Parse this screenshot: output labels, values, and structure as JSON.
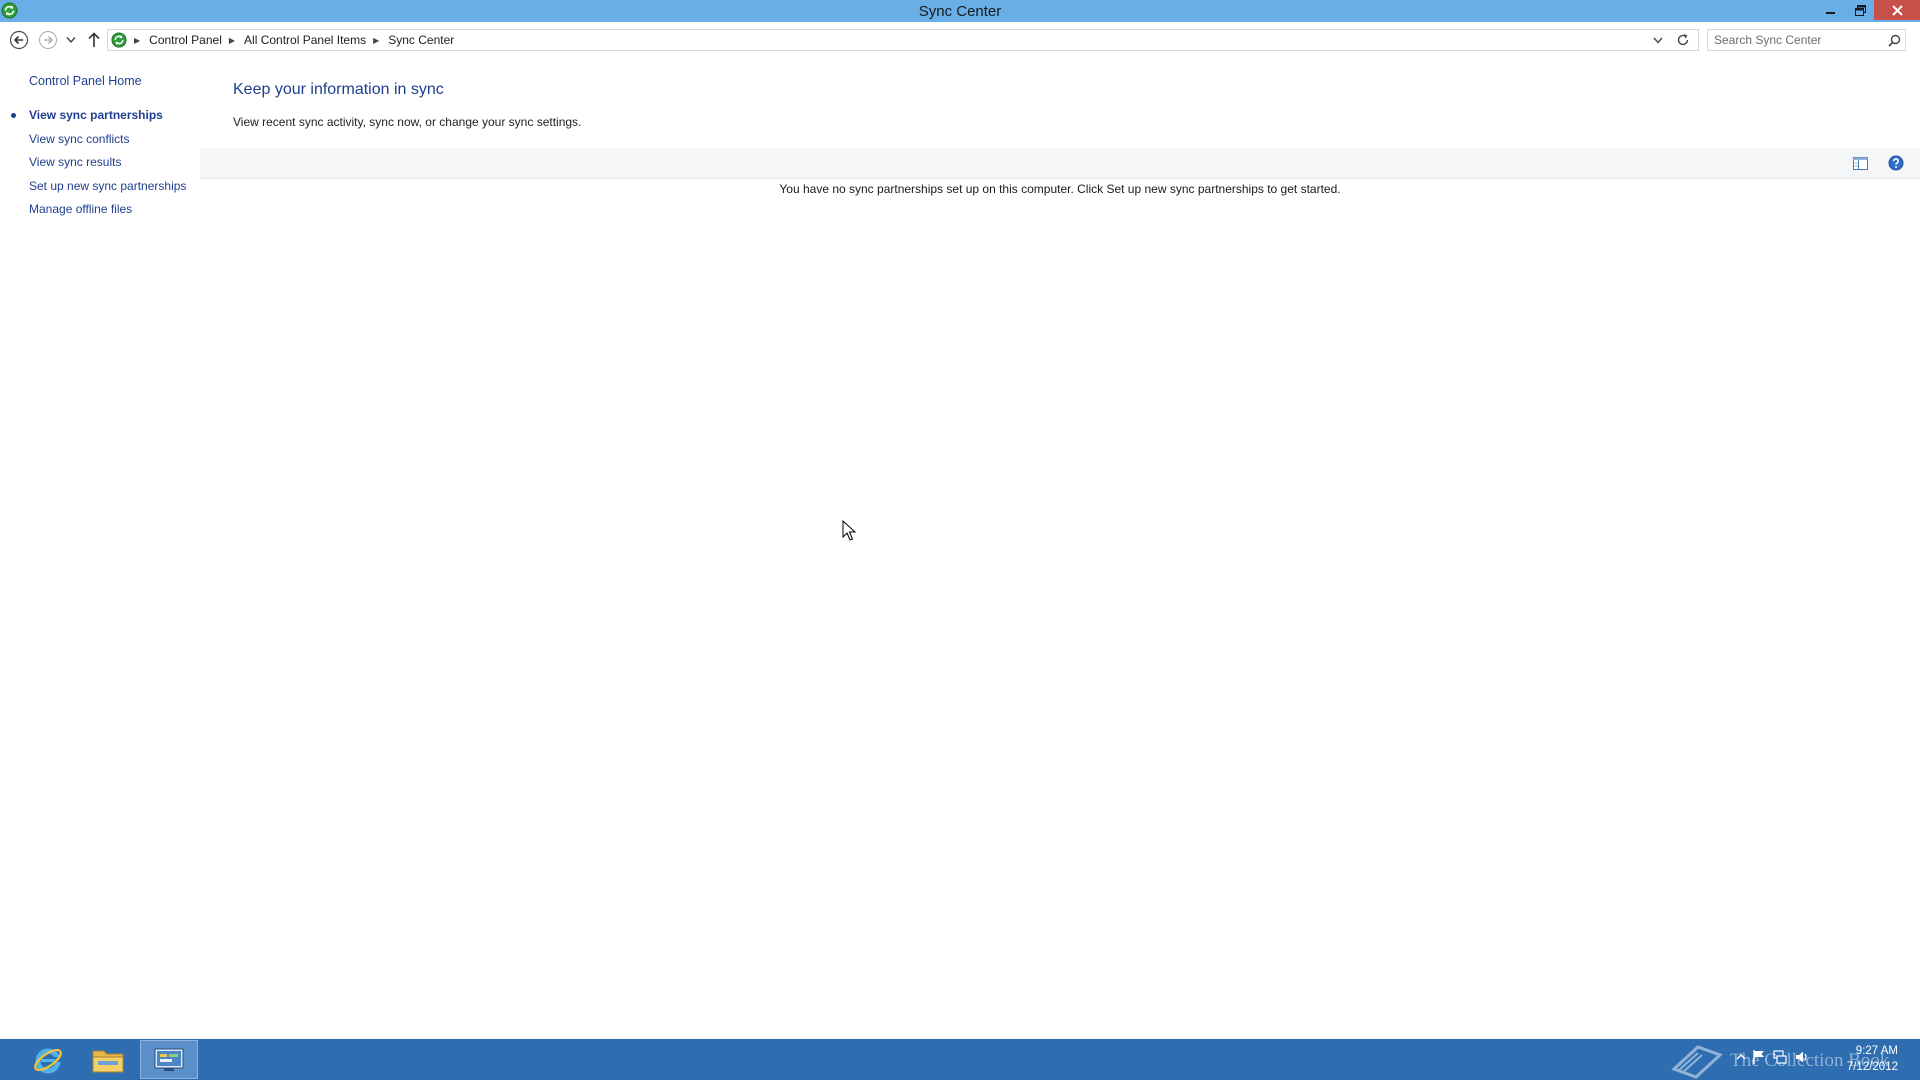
{
  "window": {
    "title": "Sync Center",
    "icon": "sync-center-icon",
    "controls": [
      "minimize-icon",
      "restore-icon",
      "close-icon"
    ]
  },
  "navigation": {
    "breadcrumbs": [
      "Control Panel",
      "All Control Panel Items",
      "Sync Center"
    ],
    "search_placeholder": "Search Sync Center"
  },
  "left_pane": {
    "home_link": "Control Panel Home",
    "tasks": [
      {
        "label": "View sync partnerships",
        "current": true
      },
      {
        "label": "View sync conflicts",
        "current": false
      },
      {
        "label": "View sync results",
        "current": false
      },
      {
        "label": "Set up new sync partnerships",
        "current": false
      },
      {
        "label": "Manage offline files",
        "current": false
      }
    ]
  },
  "main": {
    "heading": "Keep your information in sync",
    "subtext": "View recent sync activity, sync now, or change your sync settings.",
    "empty_message": "You have no sync partnerships set up on this computer. Click Set up new sync partnerships to get started."
  },
  "taskbar": {
    "apps": [
      "internet-explorer-icon",
      "file-explorer-icon",
      "control-panel-icon"
    ],
    "active_app": "control-panel-icon",
    "watermark_text": "The Collection Book",
    "time": "9:27 AM",
    "date": "7/12/2012"
  },
  "colors": {
    "titlebar": "#6aaee8",
    "close_button": "#c7504a",
    "link": "#1f3f8f",
    "heading": "#1e3f8f",
    "taskbar": "#2e6eb0",
    "toolbar": "#f5f6f7"
  }
}
